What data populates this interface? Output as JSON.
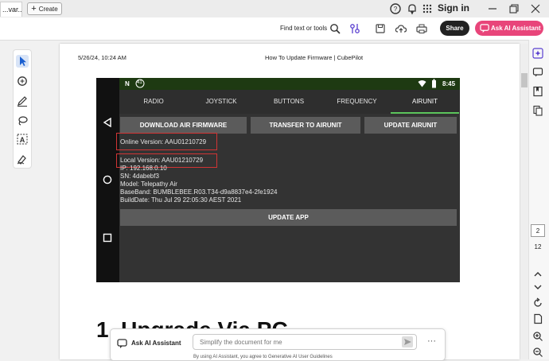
{
  "window": {
    "tab_label": "...var...",
    "tab_close": "×",
    "create_label": "Create",
    "sign_in": "Sign in"
  },
  "toolbar": {
    "find_text": "Find text or tools",
    "share_label": "Share",
    "ai_assistant_label": "Ask AI Assistant"
  },
  "document": {
    "print_date": "5/26/24, 10:24 AM",
    "print_title": "How To Update Firmware | CubePilot",
    "heading_fragment": "1. Upgrade Via PC"
  },
  "phone": {
    "status_time": "8:45",
    "status_badge": "41",
    "tabs": [
      "RADIO",
      "JOYSTICK",
      "BUTTONS",
      "FREQUENCY",
      "AIRUNIT"
    ],
    "active_tab": "AIRUNIT",
    "buttons": {
      "download": "DOWNLOAD AIR FIRMWARE",
      "transfer": "TRANSFER TO AIRUNIT",
      "update_airunit": "UPDATE AIRUNIT",
      "update_app": "UPDATE APP"
    },
    "info": {
      "online_version": "Online Version: AAU01210729",
      "local_version": "Local Version: AAU01210729",
      "ip": "IP: 192.168.0.10",
      "sn": "SN: 4dabebf3",
      "model": "Model: Telepathy Air",
      "baseband": "BaseBand: BUMBLEBEE.R03.T34-d9a8837e4-2fe1924",
      "build_date": "BuildDate: Thu Jul 29 22:05:30 AEST 2021"
    }
  },
  "ai_bar": {
    "label": "Ask AI Assistant",
    "placeholder": "Simplify the document for me",
    "more": "···",
    "disclaimer": "By using AI Assistant, you agree to Generative AI User Guidelines"
  },
  "pagination": {
    "current": "2",
    "total": "12"
  },
  "colors": {
    "accent": "#e8457a",
    "annotation_red": "#d03434",
    "tab_underline": "#5cc45c",
    "status_bar": "#1e3a12"
  }
}
